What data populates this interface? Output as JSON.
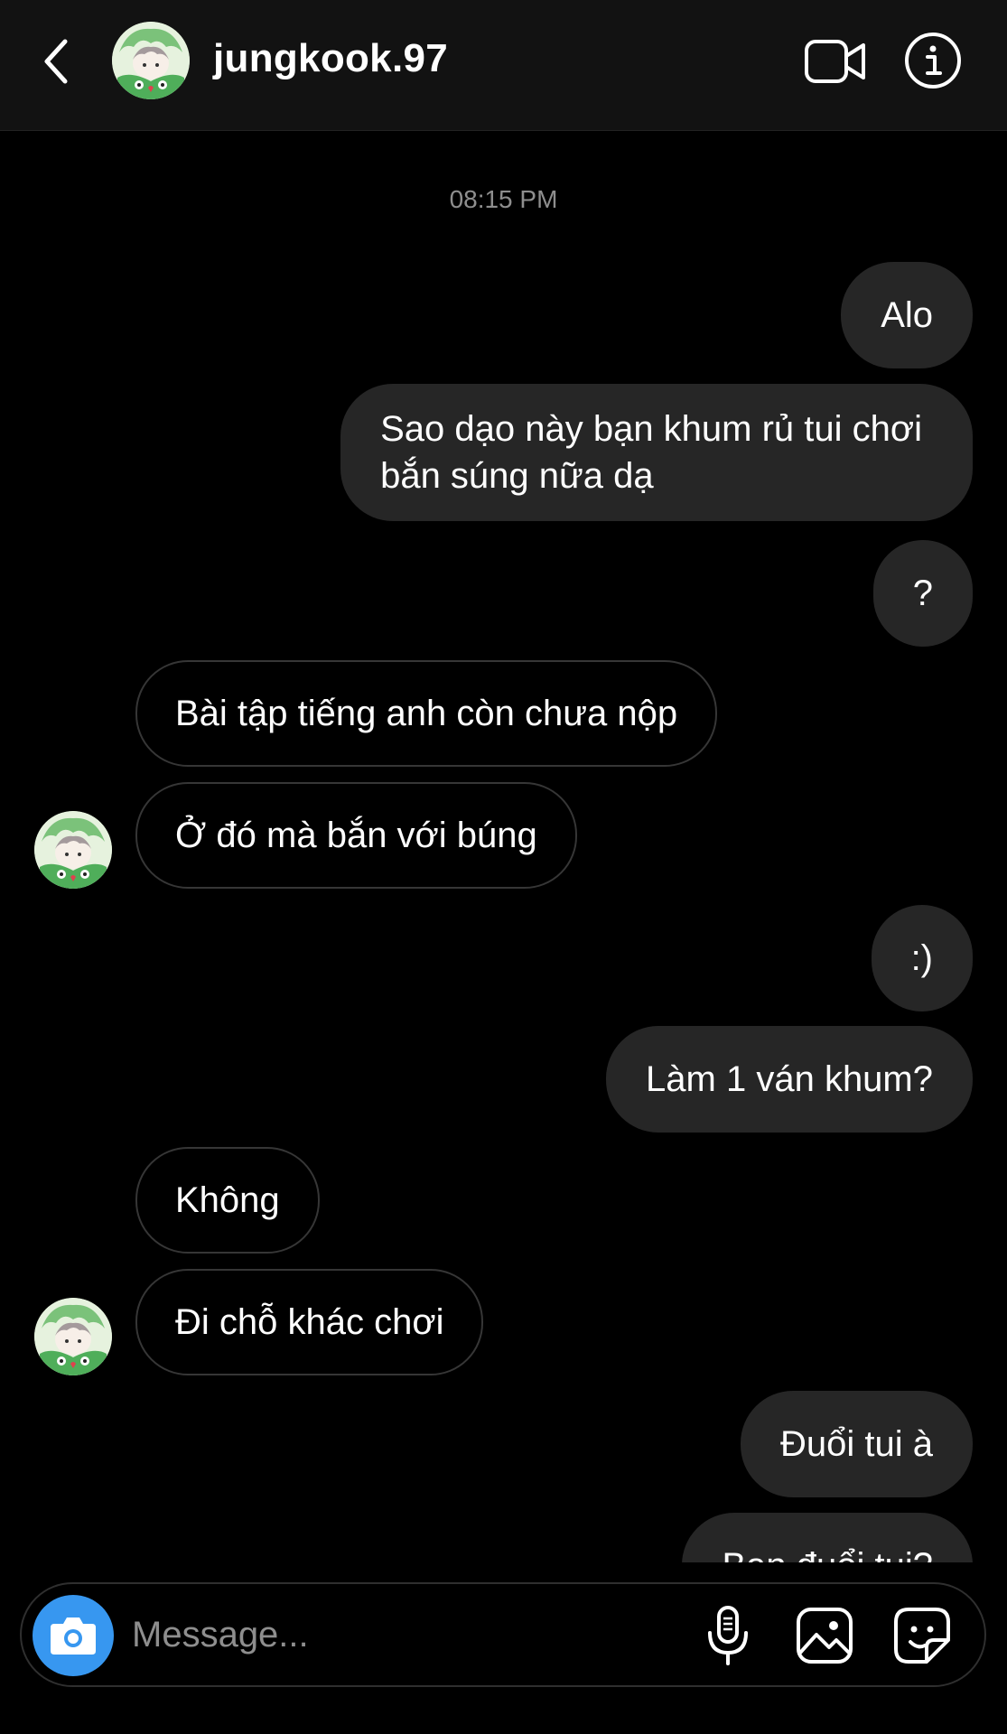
{
  "header": {
    "username": "jungkook.97",
    "back_icon": "chevron-left-icon",
    "video_icon": "video-camera-icon",
    "info_icon": "info-icon"
  },
  "conversation": {
    "timestamp": "08:15 PM",
    "messages": [
      {
        "direction": "out",
        "text": "Alo"
      },
      {
        "direction": "out",
        "text": "Sao dạo này bạn khum rủ tui chơi\nbắn súng nữa dạ"
      },
      {
        "direction": "out",
        "text": "?"
      },
      {
        "direction": "in",
        "text": "Bài tập tiếng anh còn chưa nộp"
      },
      {
        "direction": "in",
        "text": "Ở đó mà bắn với búng"
      },
      {
        "direction": "out",
        "text": ":)"
      },
      {
        "direction": "out",
        "text": "Làm 1 ván khum?"
      },
      {
        "direction": "in",
        "text": "Không"
      },
      {
        "direction": "in",
        "text": "Đi chỗ khác chơi"
      },
      {
        "direction": "out",
        "text": "Đuổi tui à"
      },
      {
        "direction": "out",
        "text": "Bạn đuổi tui?"
      }
    ]
  },
  "composer": {
    "placeholder": "Message...",
    "value": "",
    "camera_icon": "camera-icon",
    "mic_icon": "microphone-icon",
    "gallery_icon": "image-icon",
    "sticker_icon": "sticker-icon"
  },
  "colors": {
    "background": "#000000",
    "header": "#121212",
    "outgoing_bubble": "#262626",
    "incoming_border": "#363636",
    "accent": "#3797f0",
    "muted_text": "#8e8e8e"
  }
}
